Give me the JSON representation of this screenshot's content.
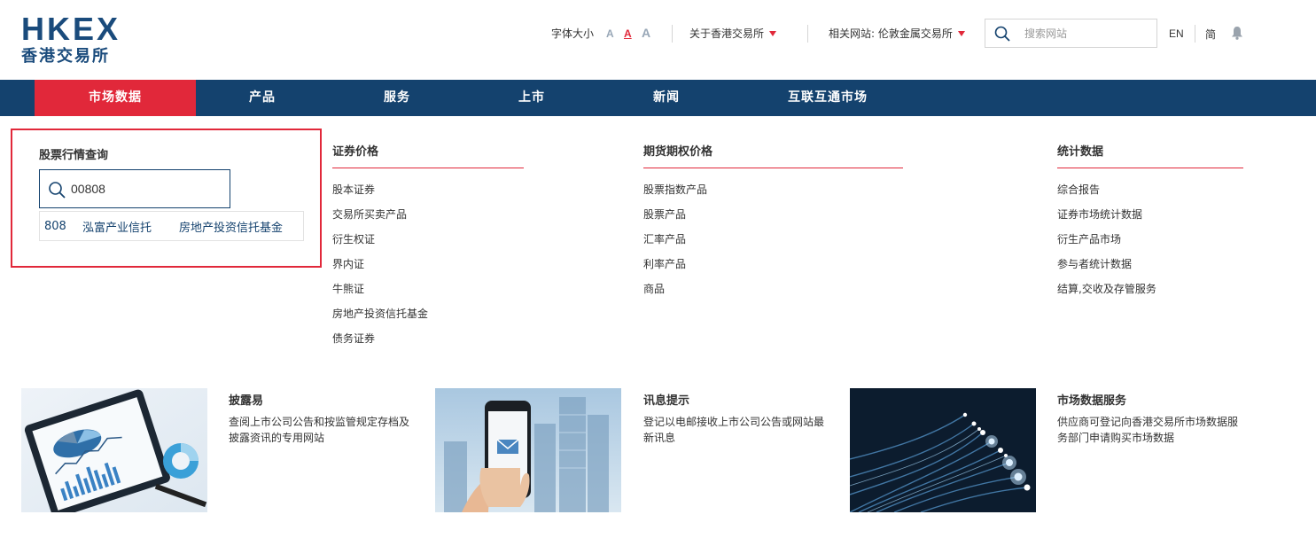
{
  "header": {
    "logo_text": "HKEX",
    "logo_cn": "香港交易所",
    "font_size_label": "字体大小",
    "font_options": [
      "A",
      "A",
      "A"
    ],
    "about_label": "关于香港交易所",
    "related_label": "相关网站: 伦敦金属交易所",
    "search_placeholder": "搜索网站",
    "lang_en": "EN",
    "lang_cn": "简",
    "colors": {
      "brand_navy": "#14426e",
      "brand_red": "#e1283a"
    }
  },
  "nav": {
    "items": [
      {
        "label": "市场数据",
        "active": true
      },
      {
        "label": "产品",
        "active": false
      },
      {
        "label": "服务",
        "active": false
      },
      {
        "label": "上市",
        "active": false
      },
      {
        "label": "新闻",
        "active": false
      },
      {
        "label": "互联互通市场",
        "active": false
      }
    ]
  },
  "quote": {
    "title": "股票行情查询",
    "input_value": "00808",
    "suggestion": {
      "code": "808",
      "name": "泓富产业信托",
      "type": "房地产投资信托基金"
    }
  },
  "menus": [
    {
      "heading": "证券价格",
      "items": [
        "股本证券",
        "交易所买卖产品",
        "衍生权证",
        "界内证",
        "牛熊证",
        "房地产投资信托基金",
        "债务证券"
      ]
    },
    {
      "heading": "期货期权价格",
      "items": [
        "股票指数产品",
        "股票产品",
        "汇率产品",
        "利率产品",
        "商品"
      ]
    },
    {
      "heading": "统计数据",
      "items": [
        "综合报告",
        "证券市场统计数据",
        "衍生产品市场",
        "参与者统计数据",
        "结算,交收及存管服务"
      ]
    }
  ],
  "cards": [
    {
      "title": "披露易",
      "desc": "查阅上市公司公告和按监管规定存档及披露资讯的专用网站",
      "image": "tablet-charts-image"
    },
    {
      "title": "讯息提示",
      "desc": "登记以电邮接收上市公司公告或网站最新讯息",
      "image": "phone-email-image"
    },
    {
      "title": "市场数据服务",
      "desc": "供应商可登记向香港交易所市场数据服务部门申请购买市场数据",
      "image": "fiber-optics-image"
    }
  ]
}
